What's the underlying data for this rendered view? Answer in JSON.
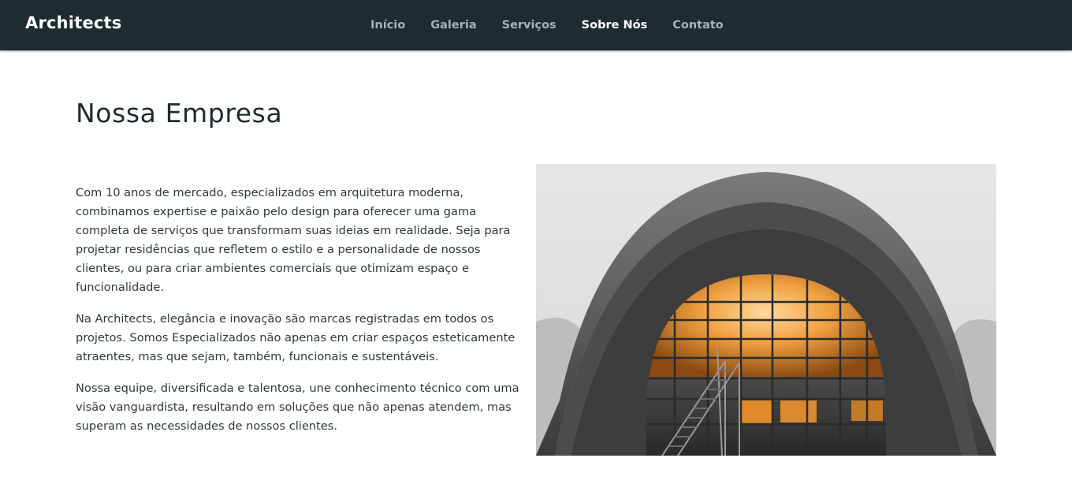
{
  "header": {
    "brand": "Architects",
    "nav": [
      {
        "label": "Início",
        "active": false
      },
      {
        "label": "Galeria",
        "active": false
      },
      {
        "label": "Serviços",
        "active": false
      },
      {
        "label": "Sobre Nós",
        "active": true
      },
      {
        "label": "Contato",
        "active": false
      }
    ]
  },
  "main": {
    "title": "Nossa Empresa",
    "paragraphs": [
      "Com 10 anos de mercado, especializados em arquitetura moderna, combinamos expertise e paixão pelo design para oferecer uma gama completa de serviços que transformam suas ideias em realidade. Seja para projetar residências que refletem o estilo e a personalidade de nossos clientes, ou para criar ambientes comerciais que otimizam espaço e funcionalidade.",
      "Na Architects, elegância e inovação são marcas registradas em todos os projetos. Somos Especializados não apenas em criar espaços esteticamente atraentes, mas que sejam, também, funcionais e sustentáveis.",
      "Nossa equipe, diversificada e talentosa, une conhecimento técnico com uma visão vanguardista, resultando em soluções que não apenas atendem, mas superam as necessidades de nossos clientes."
    ],
    "image": {
      "subject": "arched-glass-building-photo"
    }
  },
  "colors": {
    "navbar_bg": "#1e2b2f",
    "nav_text": "#a8b2b4",
    "nav_active": "#ffffff",
    "heading": "#1e2b2f",
    "body_text": "#2f3a3d",
    "glass_glow": "#f0a040"
  }
}
